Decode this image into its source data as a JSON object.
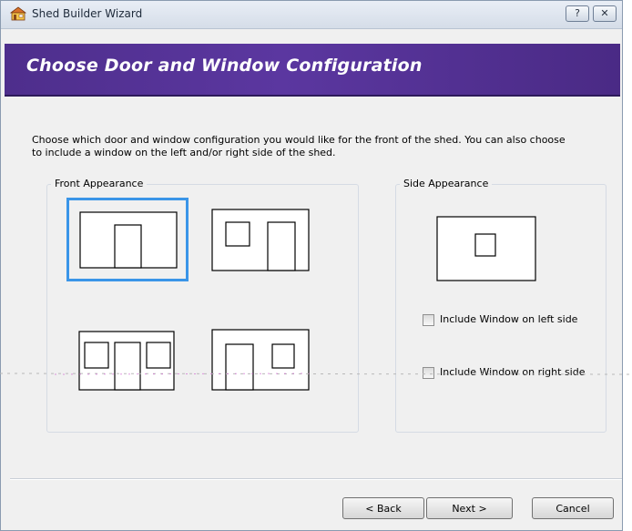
{
  "window": {
    "title": "Shed Builder Wizard",
    "help_glyph": "?",
    "close_glyph": "✕"
  },
  "header": {
    "title": "Choose Door and Window Configuration"
  },
  "instructions": "Choose which door and window configuration you would like for the front of the shed. You can also choose to include a window on the left and/or right side of the shed.",
  "front": {
    "label": "Front Appearance",
    "selected_index": 0
  },
  "side": {
    "label": "Side Appearance",
    "include_left_label": "Include Window on left side",
    "include_left_checked": false,
    "include_right_label": "Include Window on right side",
    "include_right_checked": false
  },
  "buttons": {
    "back": "< Back",
    "next": "Next >",
    "cancel": "Cancel"
  },
  "colors": {
    "banner": "#4e2e8c",
    "selection": "#3a95e8"
  },
  "icons": {
    "app": "shed-house-icon",
    "help": "help-icon",
    "close": "close-icon"
  }
}
